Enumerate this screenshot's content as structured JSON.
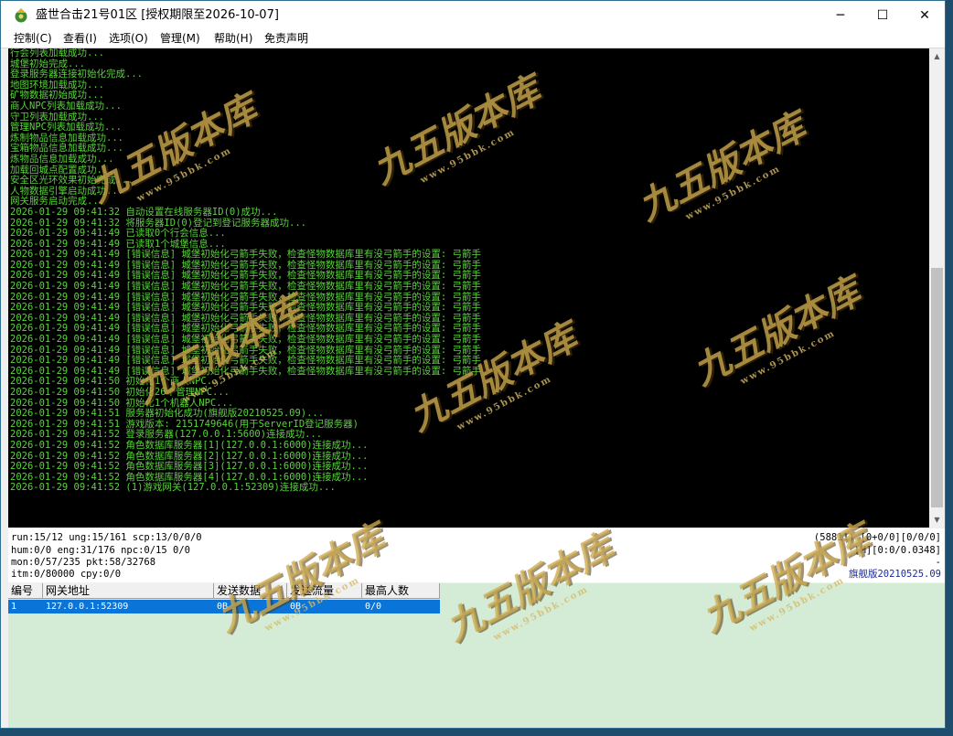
{
  "window": {
    "title": "盛世合击21号01区 [授权期限至2026-10-07]",
    "controls": {
      "minimize": "─",
      "maximize": "☐",
      "close": "✕"
    }
  },
  "menu": [
    "控制(C)",
    "查看(I)",
    "选项(O)",
    "管理(M)",
    "帮助(H)",
    "免责声明"
  ],
  "console": {
    "lines": [
      "行会列表加载成功...",
      "城堡初始完成...",
      "登录服务器连接初始化完成...",
      "地图环境加载成功...",
      "矿物数据初始成功...",
      "商人NPC列表加载成功...",
      "守卫列表加载成功...",
      "管理NPC列表加载成功...",
      "炼制物品信息加载成功...",
      "宝箱物品信息加载成功...",
      "炼物品信息加载成功...",
      "加载回城点配置成功...",
      "安全区光环效果初始完成...",
      "人物数据引擎启动成功...",
      "网关服务启动完成...",
      "2026-01-29 09:41:32 自动设置在线服务器ID(0)成功...",
      "2026-01-29 09:41:32 将服务器ID(0)登记到登记服务器成功...",
      "2026-01-29 09:41:49 已读取0个行会信息...",
      "2026-01-29 09:41:49 已读取1个城堡信息...",
      "2026-01-29 09:41:49 [错误信息] 城堡初始化弓箭手失败，检查怪物数据库里有没弓箭手的设置: 弓箭手",
      "2026-01-29 09:41:49 [错误信息] 城堡初始化弓箭手失败，检查怪物数据库里有没弓箭手的设置: 弓箭手",
      "2026-01-29 09:41:49 [错误信息] 城堡初始化弓箭手失败，检查怪物数据库里有没弓箭手的设置: 弓箭手",
      "2026-01-29 09:41:49 [错误信息] 城堡初始化弓箭手失败，检查怪物数据库里有没弓箭手的设置: 弓箭手",
      "2026-01-29 09:41:49 [错误信息] 城堡初始化弓箭手失败，检查怪物数据库里有没弓箭手的设置: 弓箭手",
      "2026-01-29 09:41:49 [错误信息] 城堡初始化弓箭手失败，检查怪物数据库里有没弓箭手的设置: 弓箭手",
      "2026-01-29 09:41:49 [错误信息] 城堡初始化弓箭手失败，检查怪物数据库里有没弓箭手的设置: 弓箭手",
      "2026-01-29 09:41:49 [错误信息] 城堡初始化弓箭手失败，检查怪物数据库里有没弓箭手的设置: 弓箭手",
      "2026-01-29 09:41:49 [错误信息] 城堡初始化弓箭手失败，检查怪物数据库里有没弓箭手的设置: 弓箭手",
      "2026-01-29 09:41:49 [错误信息] 城堡初始化弓箭手失败，检查怪物数据库里有没弓箭手的设置: 弓箭手",
      "2026-01-29 09:41:49 [错误信息] 城堡初始化弓箭手失败，检查怪物数据库里有没弓箭手的设置: 弓箭手",
      "2026-01-29 09:41:49 [错误信息] 城堡初始化弓箭手失败，检查怪物数据库里有没弓箭手的设置: 弓箭手",
      "2026-01-29 09:41:50 初始化1个商人NPC...",
      "2026-01-29 09:41:50 初始化26个管理NPC...",
      "2026-01-29 09:41:50 初始化1个机器人NPC...",
      "2026-01-29 09:41:51 服务器初始化成功(旗舰版20210525.09)...",
      "2026-01-29 09:41:51 游戏版本: 2151749646(用于ServerID登记服务器)",
      "2026-01-29 09:41:52 登录服务器(127.0.0.1:5600)连接成功...",
      "2026-01-29 09:41:52 角色数据库服务器[1](127.0.0.1:6000)连接成功...",
      "2026-01-29 09:41:52 角色数据库服务器[2](127.0.0.1:6000)连接成功...",
      "2026-01-29 09:41:52 角色数据库服务器[3](127.0.0.1:6000)连接成功...",
      "2026-01-29 09:41:52 角色数据库服务器[4](127.0.0.1:6000)连接成功...",
      "2026-01-29 09:41:52 (1)游戏网关(127.0.0.1:52309)连接成功..."
    ]
  },
  "status": {
    "left": [
      "run:15/12 ung:15/161 scp:13/0/0/0",
      "hum:0/0 eng:31/176 npc:0/15 0/0",
      "mon:0/57/235 pkt:58/32768",
      "itm:0/80000 cpy:0/0"
    ],
    "right": [
      "(58811) [0+0/0][0/0/0]",
      "[M][0:0/0.0348]",
      "-",
      "旗舰版20210525.09"
    ]
  },
  "gateway_table": {
    "columns": [
      "编号",
      "网关地址",
      "发送数据",
      "发送流量",
      "最高人数"
    ],
    "rows": [
      [
        "1",
        "127.0.0.1:52309",
        "0B",
        "0B",
        "0/0"
      ]
    ]
  },
  "watermark": {
    "text": "九五版本库",
    "url": "www.95bbk.com"
  },
  "colors": {
    "console_text": "#5ad23c",
    "console_bg": "#000000",
    "selection": "#0a74d8",
    "table_bg": "#d4ecd6"
  }
}
